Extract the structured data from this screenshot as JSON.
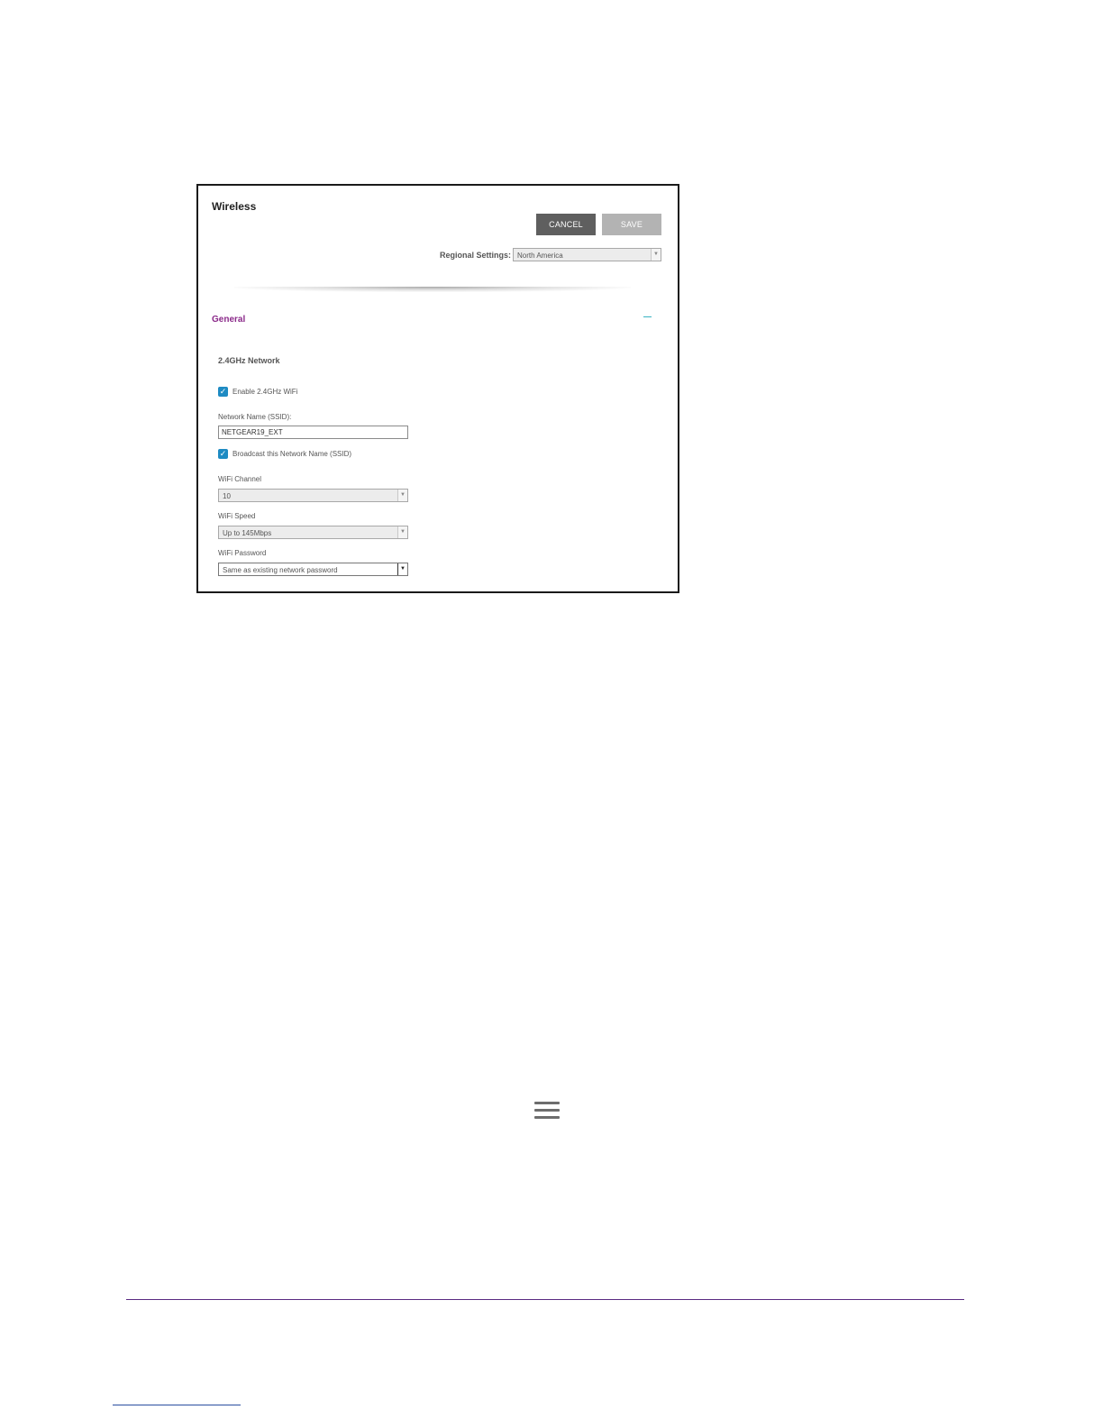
{
  "page": {
    "title": "Wireless",
    "buttons": {
      "cancel": "CANCEL",
      "save": "SAVE"
    },
    "regional": {
      "label": "Regional Settings:",
      "value": "North America"
    },
    "general": {
      "heading": "General",
      "collapse_icon": "minus-icon"
    },
    "network_24": {
      "heading": "2.4GHz Network",
      "enable_label": "Enable 2.4GHz WiFi",
      "enable_checked": true,
      "ssid_label": "Network Name (SSID):",
      "ssid_value": "NETGEAR19_EXT",
      "broadcast_label": "Broadcast this Network Name (SSID)",
      "broadcast_checked": true,
      "channel_label": "WiFi Channel",
      "channel_value": "10",
      "speed_label": "WiFi Speed",
      "speed_value": "Up to 145Mbps",
      "password_label": "WiFi Password",
      "password_value": "Same as existing network password"
    }
  },
  "colors": {
    "accent_purple": "#8b2a8a",
    "checkbox_blue": "#1e8bc3",
    "cancel_bg": "#5f5f5f",
    "save_bg": "#b3b3b3",
    "footer_rule": "#5a2a82"
  },
  "icons": {
    "menu": "hamburger-menu-icon"
  }
}
